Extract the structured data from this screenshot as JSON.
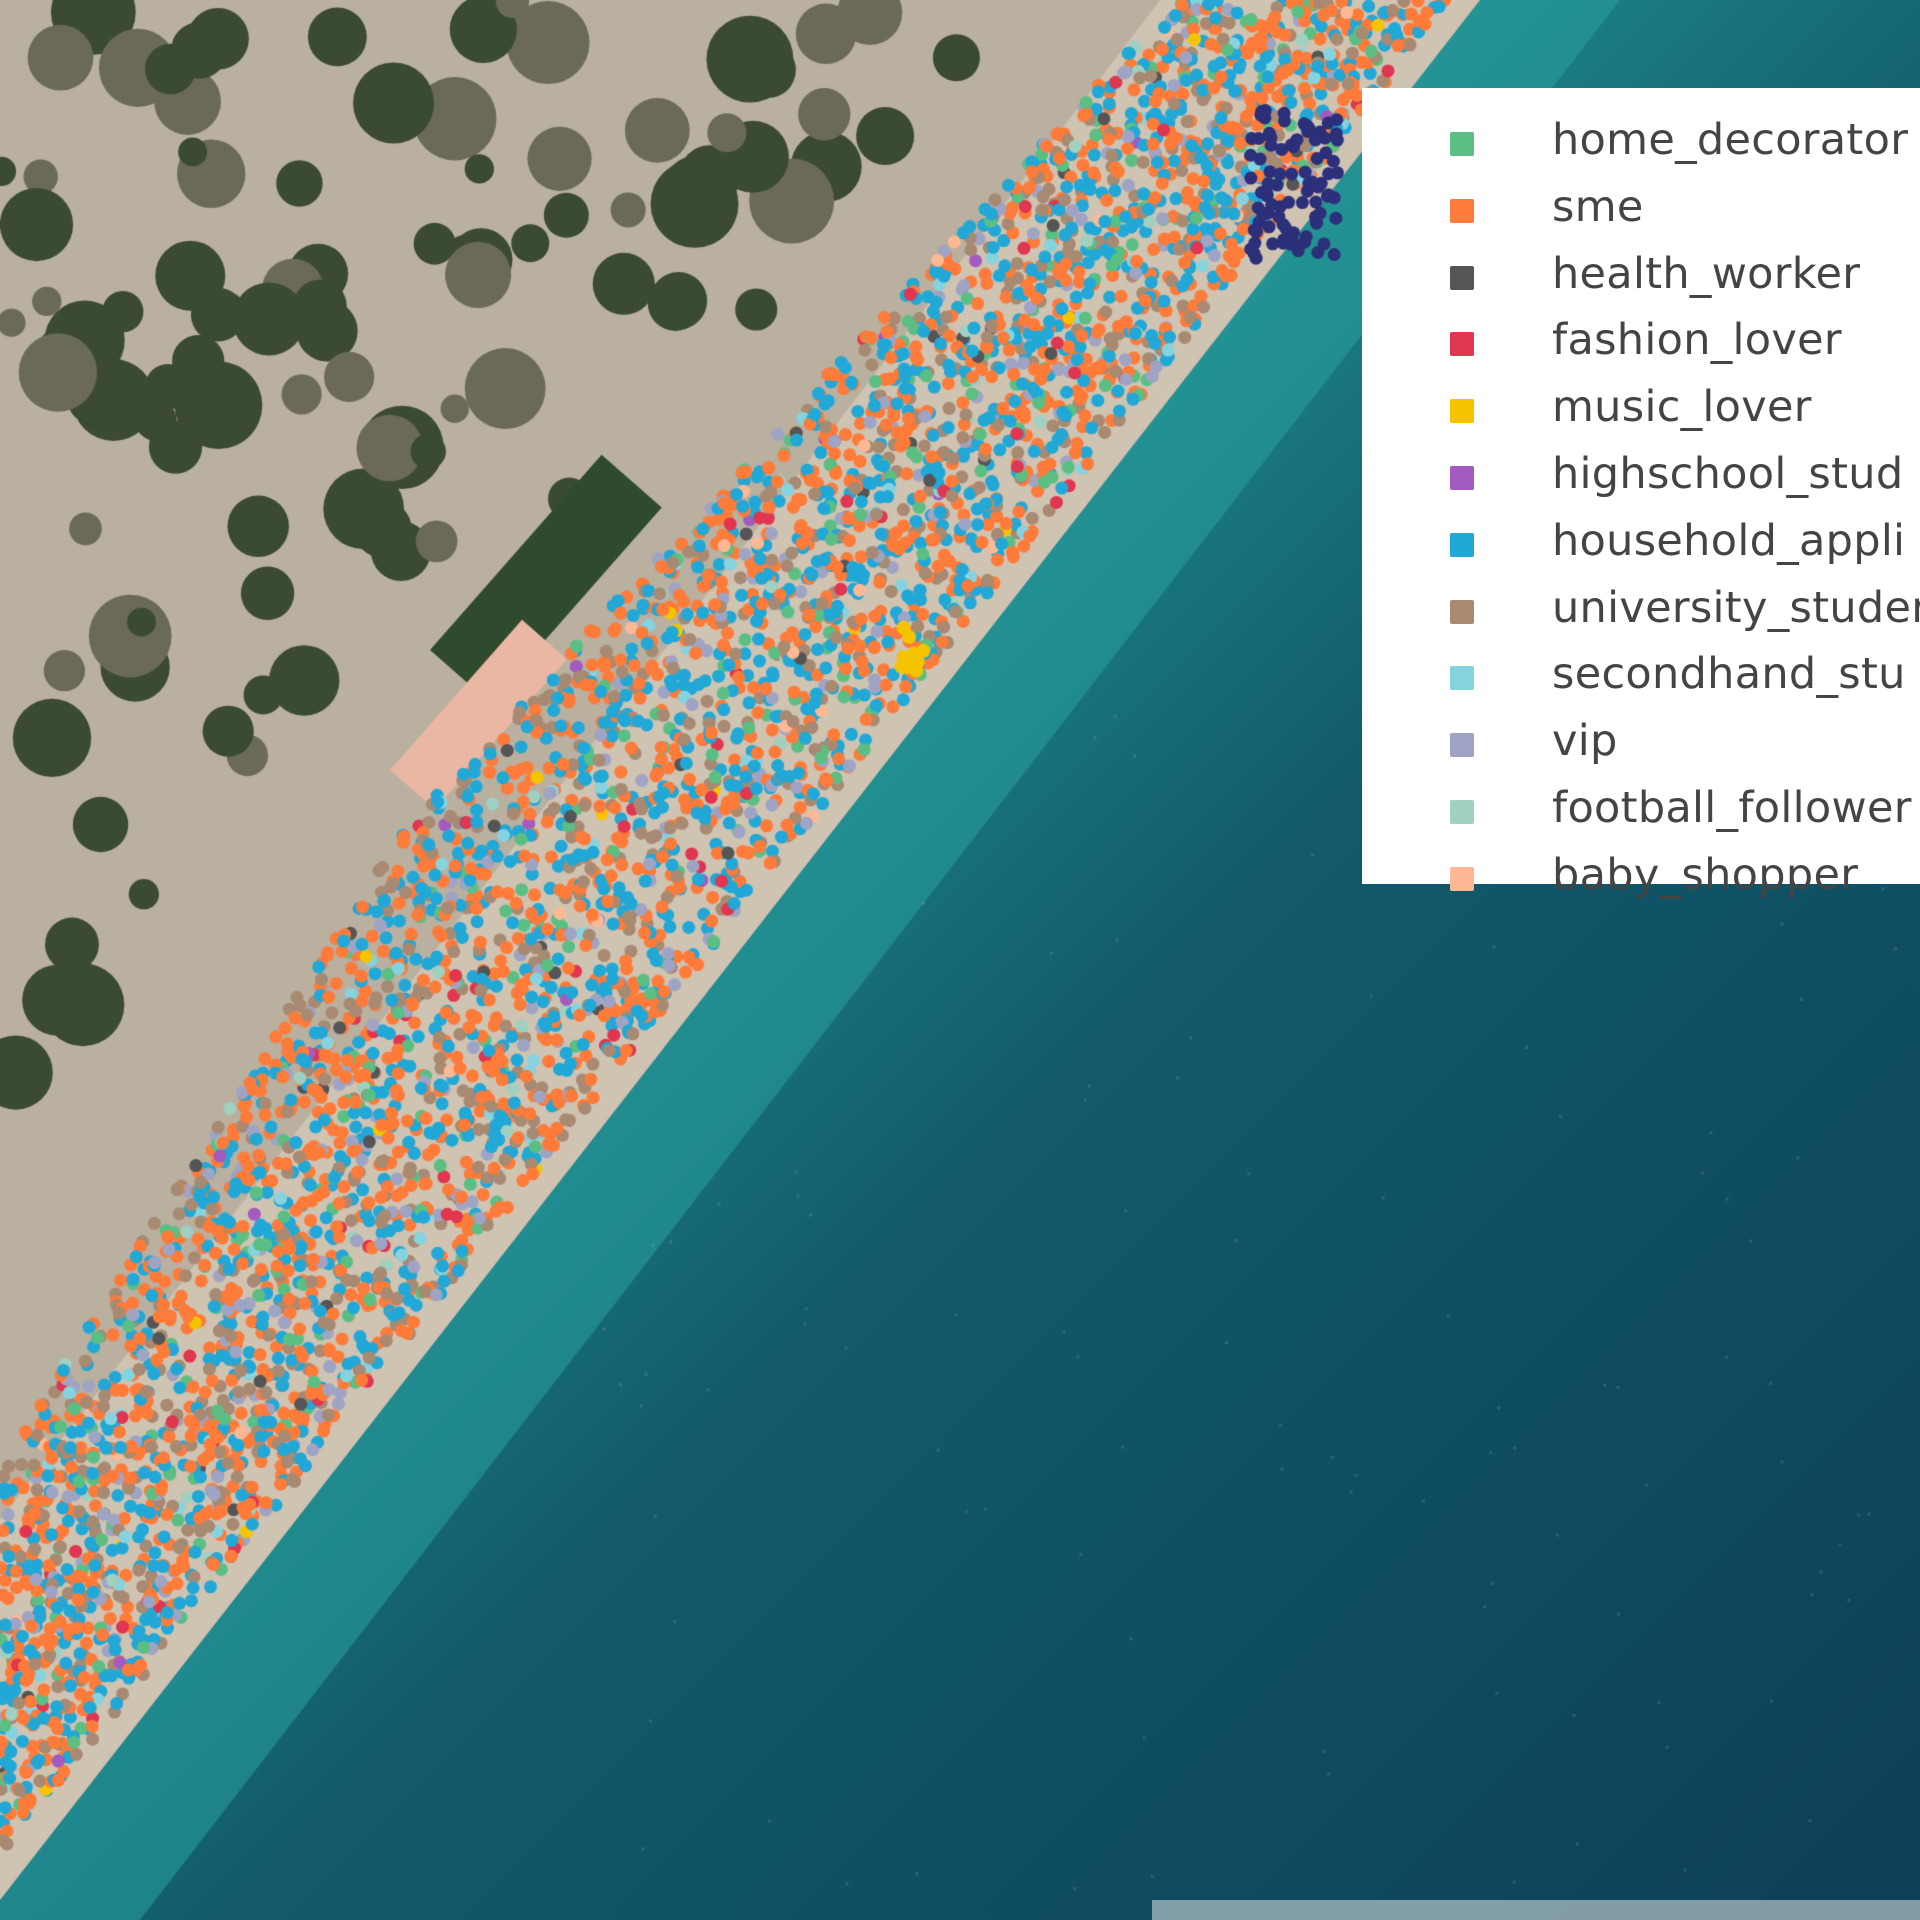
{
  "legend": {
    "items": [
      {
        "label": "home_decorator",
        "color": "#5bbf84"
      },
      {
        "label": "sme",
        "color": "#ff7b39"
      },
      {
        "label": "health_worker",
        "color": "#555555"
      },
      {
        "label": "fashion_lover",
        "color": "#e0364f"
      },
      {
        "label": "music_lover",
        "color": "#f5c400"
      },
      {
        "label": "highschool_stud",
        "color": "#a35bbf"
      },
      {
        "label": "household_appli",
        "color": "#22a8d6"
      },
      {
        "label": "university_studer",
        "color": "#a88a72"
      },
      {
        "label": "secondhand_stu",
        "color": "#86d3e0"
      },
      {
        "label": "vip",
        "color": "#9fa4c4"
      },
      {
        "label": "football_follower",
        "color": "#9fd0c0"
      },
      {
        "label": "baby_shopper",
        "color": "#ffb894"
      }
    ]
  },
  "map_colors": {
    "sea_deep": "#0d3f57",
    "sea_shallow": "#1f8a8c",
    "beach": "#cfc3b2",
    "land": "#b9b0a0",
    "vegetation": "#3a4a33",
    "cluster_dark": "#2c2f7a"
  }
}
